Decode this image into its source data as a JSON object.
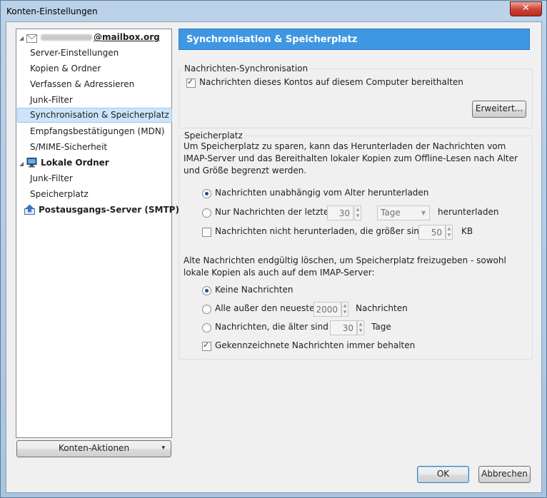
{
  "window": {
    "title": "Konten-Einstellungen",
    "close_symbol": "✕"
  },
  "tree": {
    "account": {
      "blurred_name": "",
      "domain": "@mailbox.org"
    },
    "account_items": [
      "Server-Einstellungen",
      "Kopien & Ordner",
      "Verfassen & Adressieren",
      "Junk-Filter",
      "Synchronisation & Speicherplatz",
      "Empfangsbestätigungen (MDN)",
      "S/MIME-Sicherheit"
    ],
    "local": {
      "label": "Lokale Ordner",
      "items": [
        "Junk-Filter",
        "Speicherplatz"
      ]
    },
    "smtp": {
      "label": "Postausgangs-Server (SMTP)"
    },
    "selected": "Synchronisation & Speicherplatz"
  },
  "account_actions": {
    "label": "Konten-Aktionen",
    "arrow": "▾"
  },
  "panel": {
    "header": "Synchronisation & Speicherplatz",
    "sync": {
      "title": "Nachrichten-Synchronisation",
      "keep_label": "Nachrichten dieses Kontos auf diesem Computer bereithalten",
      "keep_checked": true,
      "advanced_button": "Erweitert..."
    },
    "storage": {
      "title": "Speicherplatz",
      "description": "Um Speicherplatz zu sparen, kann das Herunterladen der Nachrichten vom IMAP-Server und das Bereithalten lokaler Kopien zum Offline-Lesen nach Alter und Größe begrenzt werden.",
      "opt_all": "Nachrichten unabhängig vom Alter herunterladen",
      "opt_last": "Nur Nachrichten der letzten",
      "last_value": "30",
      "last_unit": "Tage",
      "last_suffix": "herunterladen",
      "size_label": "Nachrichten nicht herunterladen, die größer sind als",
      "size_value": "50",
      "size_unit": "KB",
      "delete_desc": "Alte Nachrichten endgültig löschen, um Speicherplatz freizugeben - sowohl lokale Kopien als auch auf dem IMAP-Server:",
      "del_none": "Keine Nachrichten",
      "del_except": "Alle außer den neuesten",
      "del_except_value": "2000",
      "del_except_unit": "Nachrichten",
      "del_older": "Nachrichten, die älter sind als",
      "del_older_value": "30",
      "del_older_unit": "Tage",
      "keep_flagged": "Gekennzeichnete Nachrichten immer behalten",
      "keep_flagged_checked": true
    }
  },
  "footer": {
    "ok": "OK",
    "cancel": "Abbrechen"
  }
}
